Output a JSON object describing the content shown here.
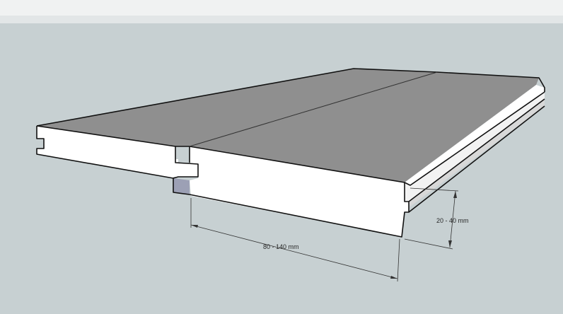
{
  "scene": {
    "background_color": "#c7d0d2",
    "sky_color": "#f0f2f2",
    "top_face_color": "#8f8f8f",
    "front_face_color": "#ffffff",
    "tongue_shadow_color": "#9ca0b5",
    "edge_color": "#111111",
    "dimension_line_color": "#333333"
  },
  "dimensions": {
    "width_label": "80 - 140 mm",
    "thickness_label": "20 - 40 mm"
  }
}
